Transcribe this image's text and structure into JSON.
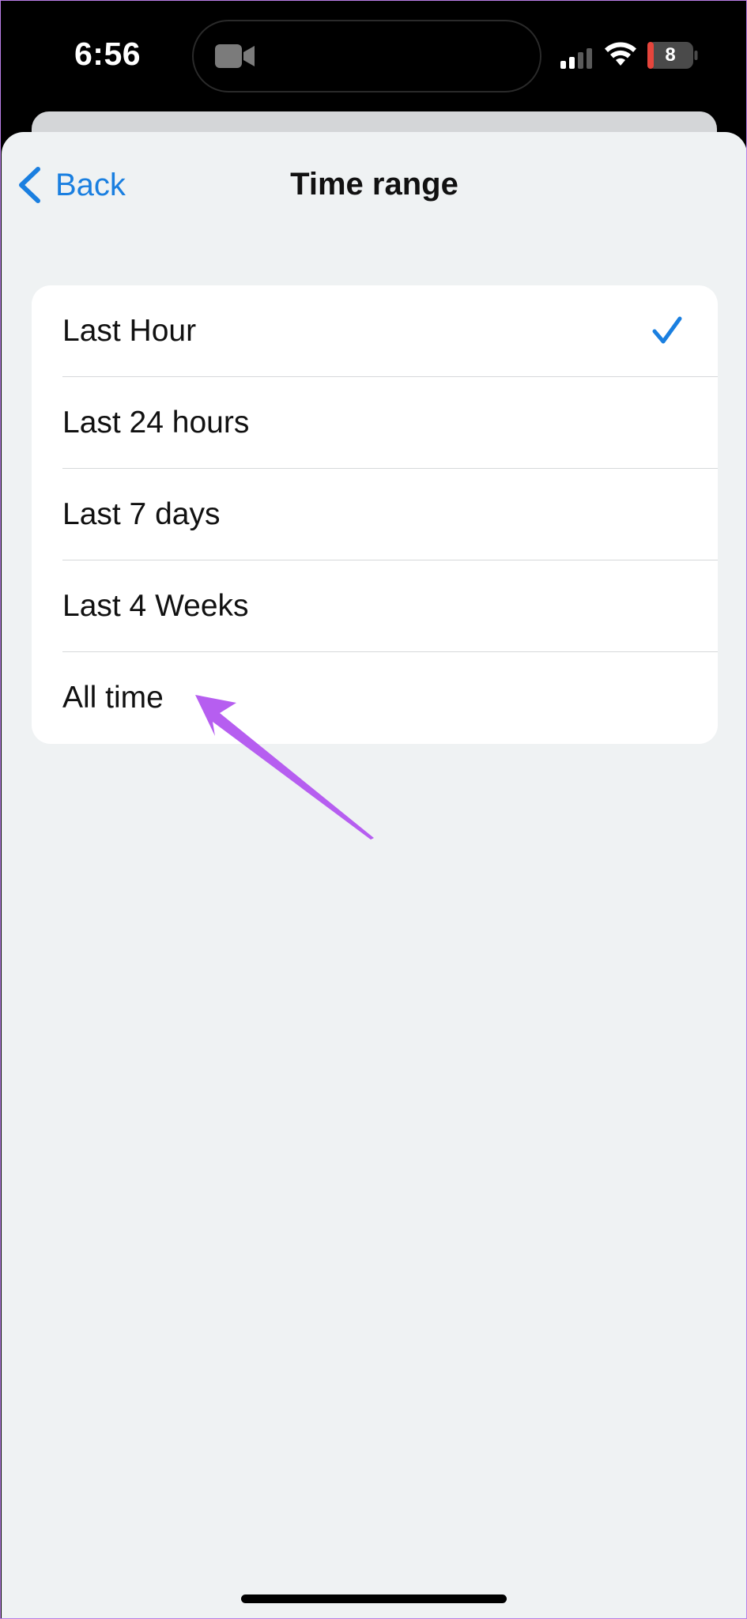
{
  "status_bar": {
    "time": "6:56",
    "battery_level": "8",
    "icons": [
      "camera-icon",
      "cellular-signal-icon",
      "wifi-icon",
      "battery-icon"
    ]
  },
  "nav": {
    "back_label": "Back",
    "title": "Time range"
  },
  "time_range": {
    "options": [
      {
        "label": "Last Hour",
        "selected": true
      },
      {
        "label": "Last 24 hours",
        "selected": false
      },
      {
        "label": "Last 7 days",
        "selected": false
      },
      {
        "label": "Last 4 Weeks",
        "selected": false
      },
      {
        "label": "All time",
        "selected": false
      }
    ],
    "selected_index": 0
  },
  "colors": {
    "accent": "#1a7fe0",
    "sheet_background": "#eff2f3",
    "card_background": "#ffffff",
    "annotation_arrow": "#b65ef0",
    "text": "#111111"
  }
}
